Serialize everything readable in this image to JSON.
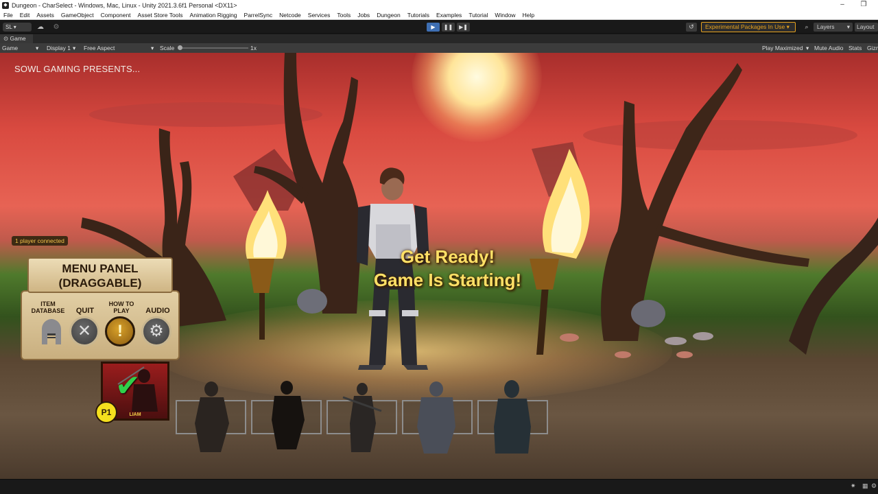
{
  "window": {
    "title": "Dungeon - CharSelect - Windows, Mac, Linux - Unity 2021.3.6f1 Personal <DX11>",
    "minimize_glyph": "–",
    "maximize_glyph": "❐"
  },
  "menu": [
    "File",
    "Edit",
    "Assets",
    "GameObject",
    "Component",
    "Asset Store Tools",
    "Animation Rigging",
    "ParrelSync",
    "Netcode",
    "Services",
    "Tools",
    "Jobs",
    "Dungeon",
    "Tutorials",
    "Examples",
    "Tutorial",
    "Window",
    "Help"
  ],
  "toolbar": {
    "account_label": "SL ▾",
    "experimental_label": "Experimental Packages In Use ▾",
    "layers_label": "Layers",
    "layout_label": "Layout",
    "play_icon": "▶",
    "pause_icon": "❚❚",
    "step_icon": "▶❚",
    "accent_color": "#e6a21e"
  },
  "game_tab": {
    "label": "Game",
    "view_mode": "Game",
    "display": "Display 1",
    "aspect": "Free Aspect",
    "scale_label": "Scale",
    "scale_value": "1x",
    "play_mode": "Play Maximized",
    "mute_audio": "Mute Audio",
    "stats": "Stats",
    "gizmos": "Gizm"
  },
  "scene": {
    "presents": "SOWL GAMING PRESENTS...",
    "players_connected": "1 player connected",
    "get_ready_line1": "Get Ready!",
    "get_ready_line2": "Game Is Starting!"
  },
  "menu_panel": {
    "title_line1": "MENU PANEL",
    "title_line2": "(DRAGGABLE)",
    "item_database_line1": "ITEM",
    "item_database_line2": "DATABASE",
    "quit": "QUIT",
    "how_to_play_line1": "HOW TO",
    "how_to_play_line2": "PLAY",
    "audio": "AUDIO"
  },
  "character_select": {
    "selected_name": "LIAM",
    "player_badge": "P1",
    "slots": 6
  }
}
